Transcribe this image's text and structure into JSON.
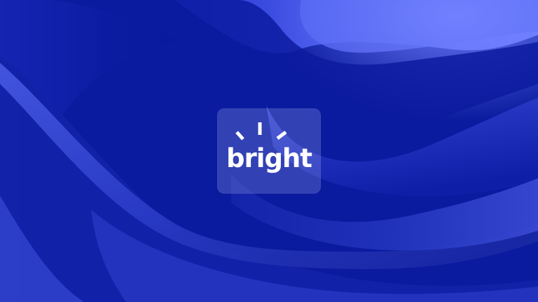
{
  "brand": {
    "name": "bright",
    "text_color": "#ffffff",
    "tile_color": "rgba(190,200,255,0.22)"
  },
  "background": {
    "base_color": "#0a1a9e",
    "highlight_color": "#5a6cf0"
  }
}
